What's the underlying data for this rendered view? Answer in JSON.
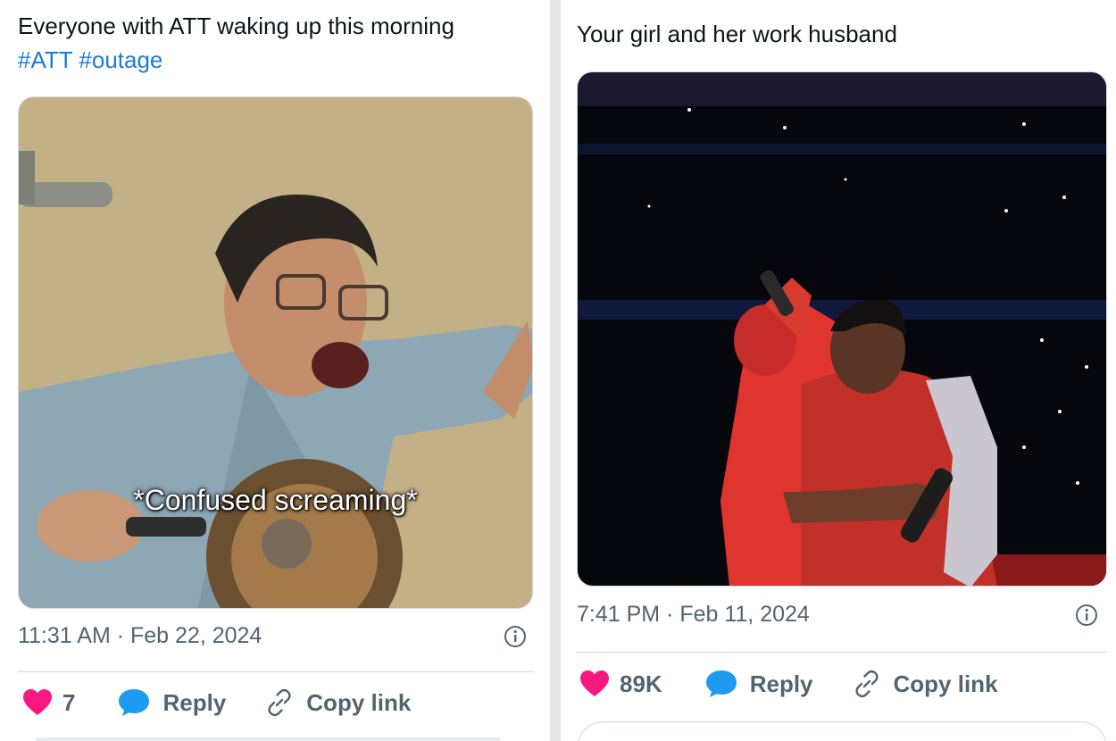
{
  "left_tweet": {
    "text": "Everyone with ATT waking up this morning",
    "hashtags": [
      "#ATT",
      "#outage"
    ],
    "media_caption": "*Confused screaming*",
    "timestamp": "11:31 AM · Feb 22, 2024",
    "likes": "7",
    "reply_label": "Reply",
    "copy_label": "Copy link"
  },
  "right_tweet": {
    "text": "Your girl and her work husband",
    "timestamp": "7:41 PM · Feb 11, 2024",
    "likes": "89K",
    "reply_label": "Reply",
    "copy_label": "Copy link"
  },
  "colors": {
    "like": "#f91880",
    "reply": "#1d9bf0",
    "hashtag": "#1d7bd8",
    "muted": "#536471"
  },
  "icons": [
    "heart-icon",
    "reply-bubble-icon",
    "link-icon",
    "info-icon"
  ]
}
